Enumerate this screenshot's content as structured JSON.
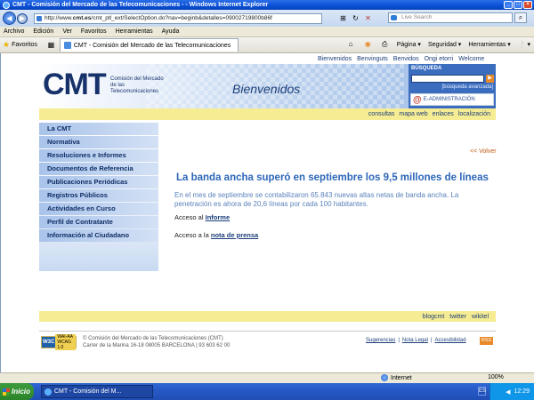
{
  "window": {
    "title": "CMT - Comisión del Mercado de las Telecomunicaciones - - Windows Internet Explorer",
    "min": "_",
    "max": "□",
    "close": "×"
  },
  "browser": {
    "address_prefix": "http://www.",
    "address_domain": "cmt.es",
    "address_rest": "/cmt_ptl_ext/SelectOption.do?nav=beginb&detalles=09002719800b86f",
    "search_placeholder": "Live Search",
    "search_icon": "⌕",
    "back_icon": "◀",
    "forward_icon": "▶",
    "menu": [
      "Archivo",
      "Edición",
      "Ver",
      "Favoritos",
      "Herramientas",
      "Ayuda"
    ],
    "favorites_label": "Favoritos",
    "tab_label": "CMT - Comisión del Mercado de las Telecomunicaciones",
    "commands": [
      "Página ▾",
      "Seguridad ▾",
      "Herramientas ▾",
      "❔ ▾"
    ],
    "status_zone": "Internet",
    "zoom": "100%"
  },
  "page": {
    "top_links": [
      "Bienvenidos",
      "Benvinguts",
      "Benvidos",
      "Ongi etorri",
      "Welcome"
    ],
    "logo": "CMT",
    "logo_sub": "Comisión del Mercado de las Telecomunicaciones",
    "welcome": "Bienvenidos",
    "search_label": "BÚSQUEDA",
    "search_go": "▶",
    "advanced_search": "[búsqueda avanzada]",
    "eadmin": "E-ADMINISTRACIÓN",
    "utility_links": [
      "consultas",
      "mapa web",
      "enlaces",
      "localización"
    ],
    "nav": [
      "La CMT",
      "Normativa",
      "Resoluciones e Informes",
      "Documentos de Referencia",
      "Publicaciones Periódicas",
      "Registros Públicos",
      "Actividades en Curso",
      "Perfil de Contratante",
      "Información al Ciudadano"
    ],
    "back": "<< Volver",
    "headline": "La banda ancha superó en septiembre los 9,5 millones de líneas",
    "lead": "En el mes de septiembre se contabilizaron 65.843 nuevas altas netas de banda ancha. La penetración es ahora de 20,6 líneas por cada 100 habitantes.",
    "access1_text": "Acceso al ",
    "access1_link": "Informe",
    "access2_text": "Acceso a la ",
    "access2_link": "nota de prensa",
    "footer_links": [
      "blogcmt",
      "twitter",
      "wikitel"
    ],
    "w3c_label": "W3C",
    "wai_label": "WAI-AA",
    "wcag_label": "WCAG 1.0",
    "copyright_line1": "© Comisión del Mercado de las Telecomunicaciones (CMT)",
    "copyright_line2": "Carrer de la Marina 16-18 08005 BARCELONA | 93 603 62 00",
    "legal_links": [
      "Sugerencias",
      "Nota Legal",
      "Accesibilidad"
    ],
    "rss": "RSS"
  },
  "taskbar": {
    "start": "Inicio",
    "item": "CMT - Comisión del M...",
    "lang": "ES",
    "time": "12:29"
  }
}
